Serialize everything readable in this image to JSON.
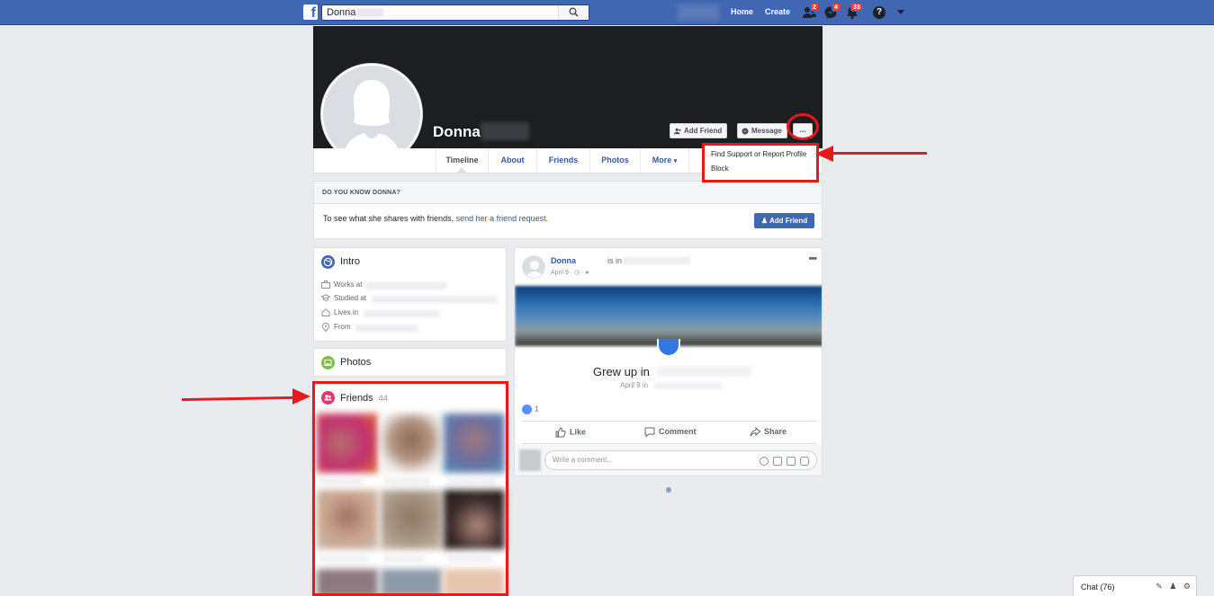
{
  "topbar": {
    "search_value": "Donna",
    "home": "Home",
    "create": "Create",
    "badges": {
      "friend_requests": "2",
      "messages": "4",
      "notifications": "33"
    },
    "help": "?"
  },
  "profile": {
    "name": "Donna",
    "buttons": {
      "add_friend": "Add Friend",
      "message": "Message",
      "more": "..."
    },
    "tabs": [
      "Timeline",
      "About",
      "Friends",
      "Photos",
      "More"
    ],
    "dropdown": [
      "Find Support or Report Profile",
      "Block"
    ]
  },
  "know_box": {
    "heading": "DO YOU KNOW DONNA?",
    "text": "To see what she shares with friends,",
    "link": "send her a friend request.",
    "button": "Add Friend"
  },
  "intro": {
    "title": "Intro",
    "rows": [
      "Works at",
      "Studied at",
      "Lives in",
      "From"
    ]
  },
  "photos": {
    "title": "Photos"
  },
  "friends": {
    "title": "Friends",
    "count": "44"
  },
  "post": {
    "author": "Donna",
    "is_in": "is in",
    "date": "April 9",
    "life_event_title": "Grew up in",
    "life_event_sub": "April 9 in",
    "like_count": "1",
    "actions": {
      "like": "Like",
      "comment": "Comment",
      "share": "Share"
    },
    "comment_placeholder": "Write a comment..."
  },
  "chat": {
    "label": "Chat (76)"
  },
  "colors": {
    "brand": "#4267b2",
    "annotation": "#e8181d",
    "link": "#385898"
  }
}
